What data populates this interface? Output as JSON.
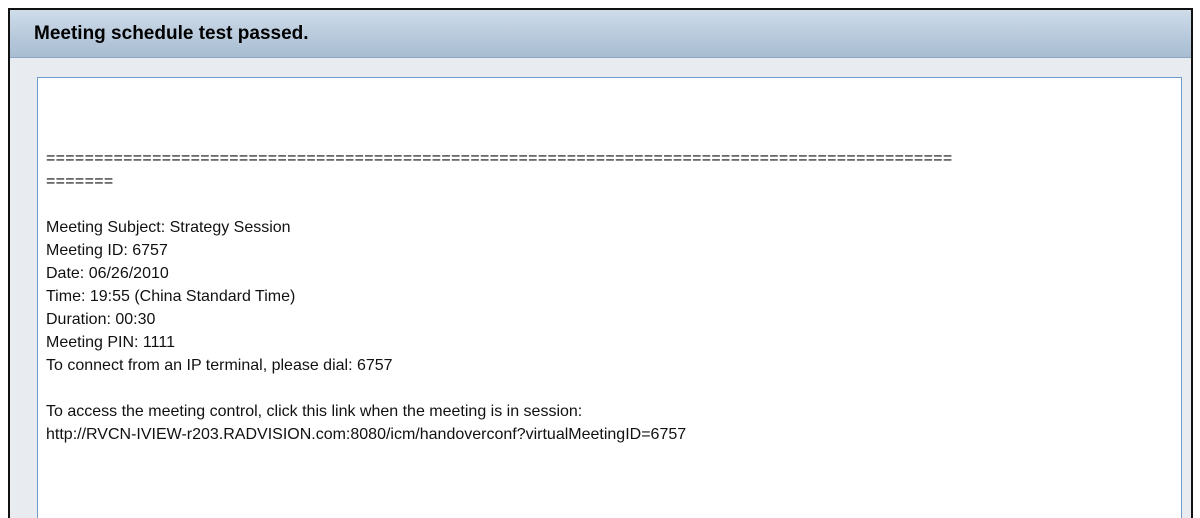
{
  "window": {
    "title": "Meeting schedule test passed."
  },
  "message": {
    "separator_line_1": "==============================================================================================",
    "separator_line_2": "=======",
    "details": [
      "Meeting Subject: Strategy Session",
      "Meeting ID: 6757",
      "Date: 06/26/2010",
      "Time: 19:55 (China Standard Time)",
      "Duration: 00:30",
      "Meeting PIN: 1111",
      "To connect from an IP terminal, please dial: 6757"
    ],
    "access_text": "To access the meeting control, click this link when the meeting is in session:",
    "access_link": "http://RVCN-IVIEW-r203.RADVISION.com:8080/icm/handoverconf?virtualMeetingID=6757"
  }
}
